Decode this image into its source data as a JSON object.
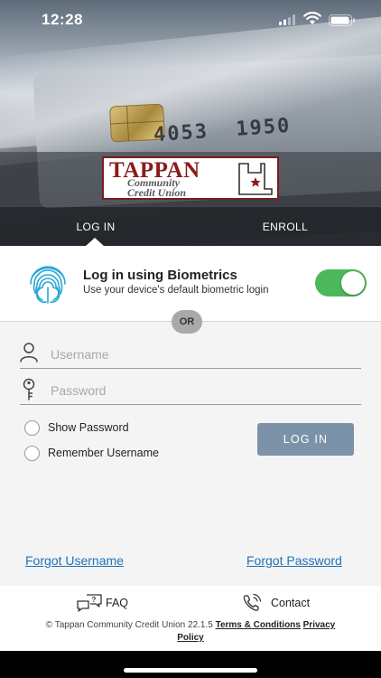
{
  "status_bar": {
    "time": "12:28"
  },
  "logo": {
    "title": "TAPPAN",
    "subtitle_1": "Community",
    "subtitle_2": "Credit Union"
  },
  "tabs": [
    {
      "label": "LOG IN",
      "active": true
    },
    {
      "label": "ENROLL",
      "active": false
    }
  ],
  "biometrics": {
    "title": "Log in using Biometrics",
    "subtitle": "Use your device's default biometric login",
    "enabled": true,
    "toggle_color": "#4cb85a"
  },
  "divider": {
    "label": "OR"
  },
  "form": {
    "username": {
      "placeholder": "Username",
      "value": "",
      "icon": "user-icon"
    },
    "password": {
      "placeholder": "Password",
      "value": "",
      "icon": "key-icon"
    },
    "show_password_label": "Show Password",
    "remember_username_label": "Remember Username",
    "login_button": "LOG IN",
    "login_button_color": "#7c92a8"
  },
  "links": {
    "forgot_username": "Forgot Username",
    "forgot_password": "Forgot Password",
    "link_color": "#1f72b8"
  },
  "footer": {
    "faq_label": "FAQ",
    "contact_label": "Contact",
    "copyright": "© Tappan Community Credit Union 22.1.5",
    "terms_label": "Terms & Conditions",
    "privacy_label_1": "Privacy",
    "privacy_label_2": "Policy"
  }
}
